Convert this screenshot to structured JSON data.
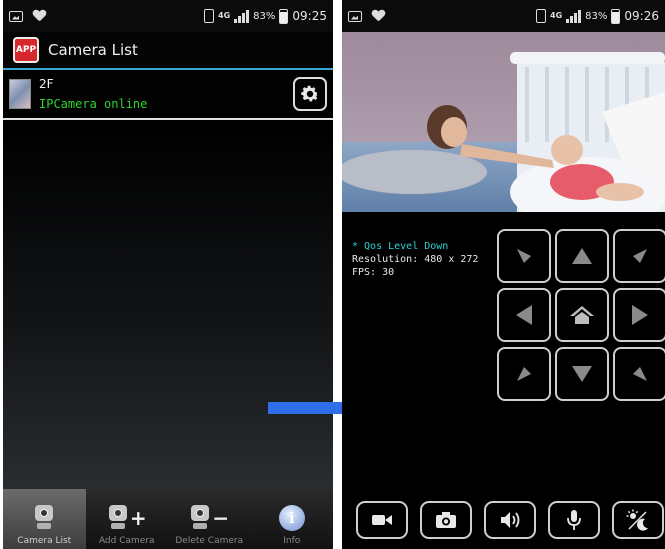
{
  "left_phone": {
    "statusbar": {
      "battery": "83%",
      "time": "09:25",
      "network": "4G"
    },
    "app": {
      "title": "Camera List",
      "icon_text": "APP"
    },
    "cameras": [
      {
        "name": "2F",
        "status": "IPCamera online"
      }
    ],
    "bottom_nav": [
      {
        "label": "Camera List",
        "icon": "camera-icon",
        "active": true
      },
      {
        "label": "Add Camera",
        "icon": "add-camera-icon",
        "active": false
      },
      {
        "label": "Delete Camera",
        "icon": "delete-camera-icon",
        "active": false
      },
      {
        "label": "Info",
        "icon": "info-icon",
        "active": false
      }
    ]
  },
  "right_phone": {
    "statusbar": {
      "battery": "83%",
      "time": "09:26",
      "network": "4G"
    },
    "stream": {
      "qos": "* Qos Level Down",
      "resolution": "Resolution: 480 x 272",
      "fps": "FPS: 30"
    },
    "ptz": [
      [
        "up-left",
        "up",
        "up-right"
      ],
      [
        "left",
        "home",
        "right"
      ],
      [
        "down-left",
        "down",
        "down-right"
      ]
    ],
    "controls": [
      "video-record-icon",
      "snapshot-icon",
      "speaker-icon",
      "microphone-icon",
      "night-mode-icon"
    ]
  },
  "colors": {
    "accent": "#3aa6d8",
    "online": "#2fd22f",
    "qos": "#2ed3d3",
    "arrow": "#2f6ee8"
  }
}
